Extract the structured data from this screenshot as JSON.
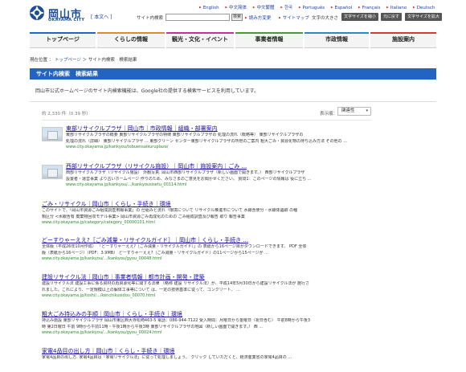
{
  "header": {
    "logo_text": "岡山市",
    "logo_sub": "OKAYAMA CITY",
    "home_link": "[ 本文へ ]",
    "languages": [
      "English",
      "中文简体",
      "中文繁體",
      "한국",
      "Português",
      "Español",
      "Français",
      "Italiano",
      "Deutsch"
    ],
    "search_label": "サイト内検索",
    "search_value": "",
    "search_button": "検索",
    "help_link": "読み方変更",
    "sitemap_link": "サイトマップ",
    "font_size_label": "文字の大きさ",
    "font_small_button": "文字サイズを縮小",
    "font_normal_button": "元に戻す",
    "font_large_button": "文字サイズを拡大"
  },
  "nav": {
    "items": [
      {
        "label": "トップページ",
        "color": "#2363c1"
      },
      {
        "label": "くらしの情報",
        "color": "#e28a2b"
      },
      {
        "label": "観光・文化・イベント",
        "color": "#c2358f"
      },
      {
        "label": "事業者情報",
        "color": "#4a9a3a"
      },
      {
        "label": "市政情報",
        "color": "#2a8ac8"
      },
      {
        "label": "施設案内",
        "color": "#d33a3a"
      }
    ]
  },
  "breadcrumb": {
    "prefix": "現在位置 ：",
    "top": "トップページ",
    "sep": " ＞ ",
    "current": "サイト内検索　検索結果"
  },
  "page_title": "サイト内検索　検索結果",
  "intro": "岡山市公式ホームページのサイト内検索機能は、Google社の提供する検索サービスを利用しています。",
  "results_meta": {
    "count": "約 2,330 件（0.39 秒）",
    "order_label": "表示順：",
    "order_value": "関連性"
  },
  "results": [
    {
      "title": "東部リサイクルプラザ｜岡山市｜市政情報｜組織・部署案内",
      "snippet1": "東部リサイクルプラザの概要 東部リサイクルプラザの特徴 東部リサイクルプラザの 処理の流れ（概略等） 東部リサイクルプラザの",
      "snippet2": "処理の流れ（詳細） 東部リサイクルプラザ ... 東部クリーン センター東部リサイクルプラザの所管のご案内 粗大ごみ・資源化物の持ち込み方法 その他の ...",
      "url": "www.city.okayama.jp/kankyou/tobuensaikuruplaza/"
    },
    {
      "title": "西部リサイクルプラザ（リサイクル施設）｜岡山市｜施設案内｜ごみ ...",
      "snippet1": "西部リサイクルプラザ（リサイクル施設） 外観写真. 岡山市西部リサイクルプラザ（新しい画面で開きます。） 西部リサイクルプラザ",
      "snippet2": "設置者・運営事業 より古いホームページ 作りのため、みなさまのご意見をお聞かせください。 質問1：このページの情報は 役に立ち ...",
      "url": "www.city.okayama.jp/kankyou/.../kankyousisetu_00114.html"
    },
    {
      "title": "ごみ・リサイクル｜岡山市｜くらし・手続き｜環境",
      "snippet1": "このサイトで、「岡山市資源ごみ組成調査用報事業」の 仕組みと流れ「環境について リサイクル推進市について 水銀含使分・水銀体遺跡 の種",
      "snippet2": "類区分 <水銀含有 廃棄物回収モデル事業> 岡山市資源ごみ再成化のための ごみ組成調査及び報告 取り 報告事業",
      "url": "www.city.okayama.jp/category/category_00000101.html"
    },
    {
      "title": "どーすりゃーええ?［ごみ減量・リサイクルガイド］｜岡山市｜くらし・手続き ...",
      "snippet1": "全体版（平成26年10月作成） 「どーすりゃーええ?［ごみ減量・リサイクルガイド］」の 表紙から16ページ目がダウンロードできます。 PDF 全体",
      "snippet2": "版（表紙から16ページ）（PDF：3.9MB） どーすりゃーええ?［ごみ減量・リサイクルガイド］の11ページから15ページが ...",
      "url": "www.city.okayama.jp/kankyou/.../kankyou/gyou_00048.html"
    },
    {
      "title": "建設リサイクル法｜岡山市｜事業者情報｜都市計画・開発・建築",
      "snippet1": "建設リサイクル法 建設工事に係る資材の再資源化等に関する法律 （略称 建設 リサイクル法）が、平成14年5月30日から建設リサイクル法が 施行さ",
      "snippet2": "れました。これにより、一定規模以上の解体工事等について は、一定の技術基準に従って、コンクリート、 ...",
      "url": "www.city.okayama.jp/toshi/.../kenchikusidou_00070.html"
    },
    {
      "title": "粗大ごみ持込みの手順｜岡山市｜くらし・手続き｜環境",
      "snippet1": "持込み施設 東部リサイクルプラザ 岡山市東区西大寺松崎463-5 電話：086-944-7122 受入時間：月曜日から金曜日（祝日含む） 午前8時から午後3",
      "snippet2": "時 第2日曜日 午前 9時から午前11時・午後1時から午後3時 東部リサイクルプラザの地図（新しい画面で開きます。） 西 ...",
      "url": "www.city.okayama.jp/kankyou/.../kankyou/gyou_00024.html"
    },
    {
      "title": "家電4品目の出し方｜岡山市｜くらし・手続き｜環境",
      "snippet1": "家電4品目の出し方. 家電4品目は「家電リサイクル法」に従って処理しましょう。 クリック していただくと、経済産業省の家電4品目の ...",
      "snippet2": "",
      "url": ""
    }
  ]
}
